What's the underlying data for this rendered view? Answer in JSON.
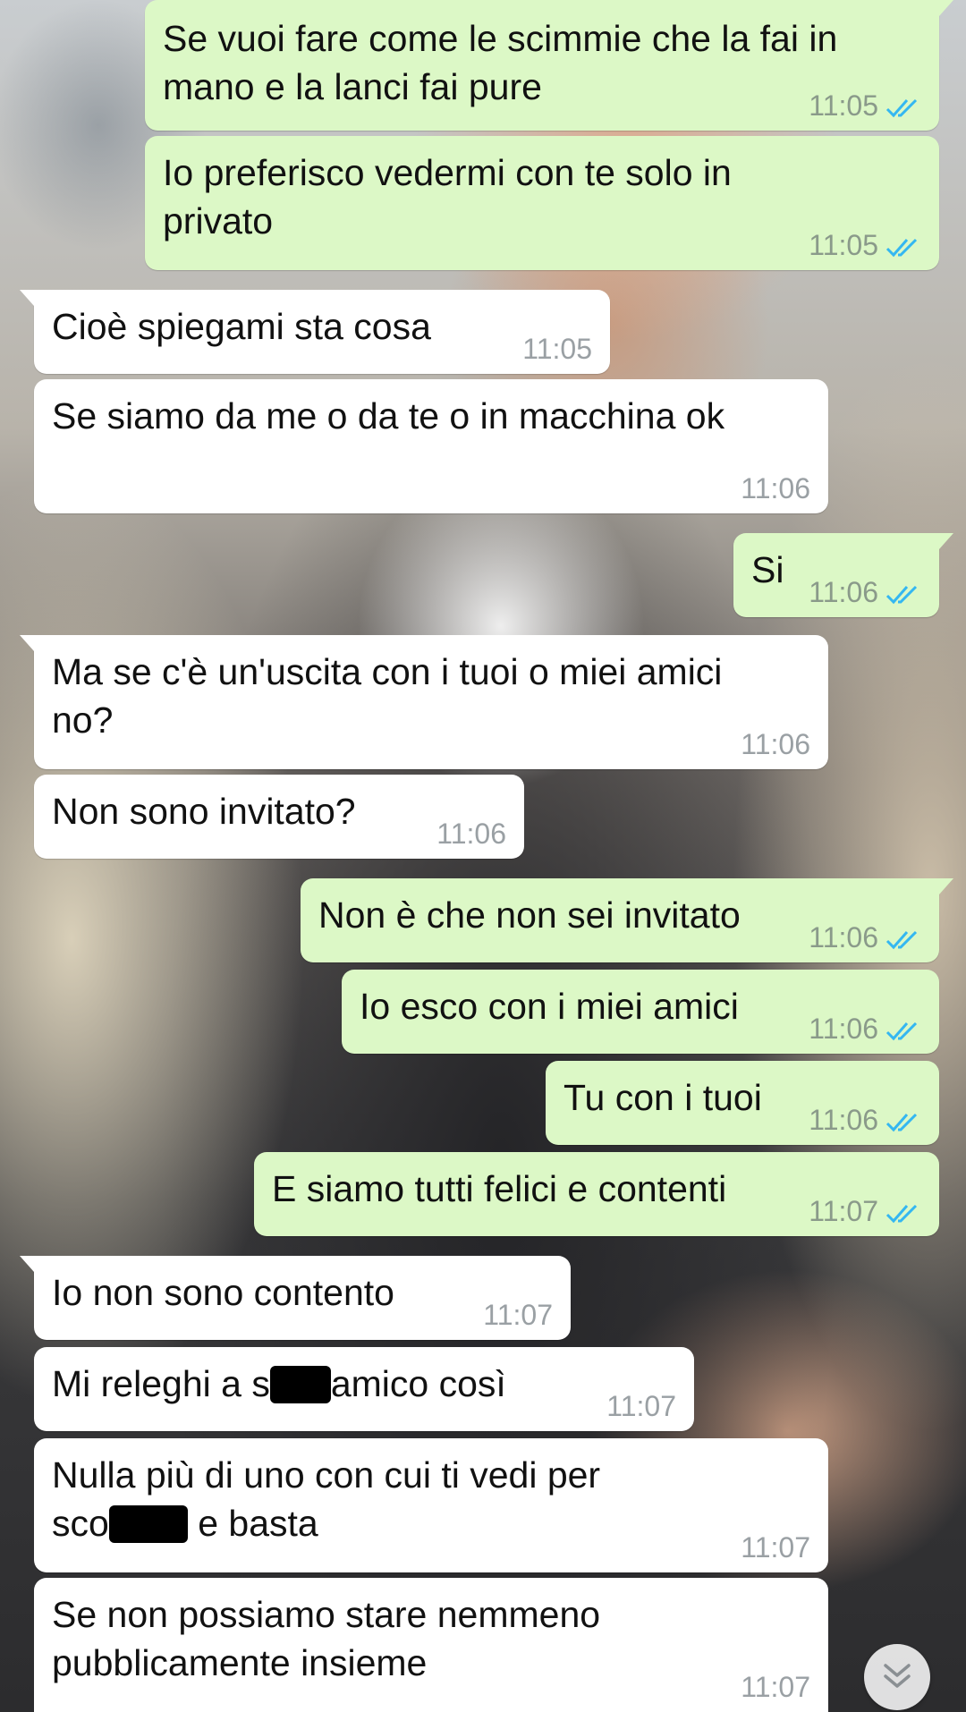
{
  "colors": {
    "incoming_bubble": "#ffffff",
    "outgoing_bubble": "#dcf8c6",
    "timestamp": "#9aa0a4",
    "read_ticks": "#34b7f1"
  },
  "messages": [
    {
      "direction": "out",
      "lines": [
        "Se vuoi fare come le scimmie che la fai in",
        "mano e la lanci fai pure"
      ],
      "time": "11:05",
      "status": "read"
    },
    {
      "direction": "out",
      "lines": [
        "Io preferisco vedermi con te solo in",
        "privato"
      ],
      "time": "11:05",
      "status": "read"
    },
    {
      "direction": "in",
      "lines": [
        "Cioè spiegami sta cosa"
      ],
      "time": "11:05"
    },
    {
      "direction": "in",
      "lines": [
        "Se siamo da me o da te o in macchina ok"
      ],
      "time": "11:06"
    },
    {
      "direction": "out",
      "lines": [
        "Si"
      ],
      "time": "11:06",
      "status": "read"
    },
    {
      "direction": "in",
      "lines": [
        "Ma se c'è un'uscita con i tuoi o miei amici",
        "no?"
      ],
      "time": "11:06"
    },
    {
      "direction": "in",
      "lines": [
        "Non sono invitato?"
      ],
      "time": "11:06"
    },
    {
      "direction": "out",
      "lines": [
        "Non è che non sei invitato"
      ],
      "time": "11:06",
      "status": "read"
    },
    {
      "direction": "out",
      "lines": [
        "Io esco con i miei amici"
      ],
      "time": "11:06",
      "status": "read"
    },
    {
      "direction": "out",
      "lines": [
        "Tu con i tuoi"
      ],
      "time": "11:06",
      "status": "read"
    },
    {
      "direction": "out",
      "lines": [
        "E siamo tutti felici e contenti"
      ],
      "time": "11:07",
      "status": "read"
    },
    {
      "direction": "in",
      "lines": [
        "Io non sono contento"
      ],
      "time": "11:07"
    },
    {
      "direction": "in",
      "parts": {
        "before": "Mi releghi a s",
        "after": "amico così"
      },
      "time": "11:07"
    },
    {
      "direction": "in",
      "lines": [
        "Nulla più di uno con cui ti vedi per"
      ],
      "parts": {
        "before": "sco",
        "after": " e basta"
      },
      "time": "11:07"
    },
    {
      "direction": "in",
      "lines": [
        "Se non possiamo stare nemmeno",
        "pubblicamente insieme"
      ],
      "time": "11:07"
    }
  ],
  "scroll_button": {
    "icon": "double-chevron-down-icon"
  }
}
